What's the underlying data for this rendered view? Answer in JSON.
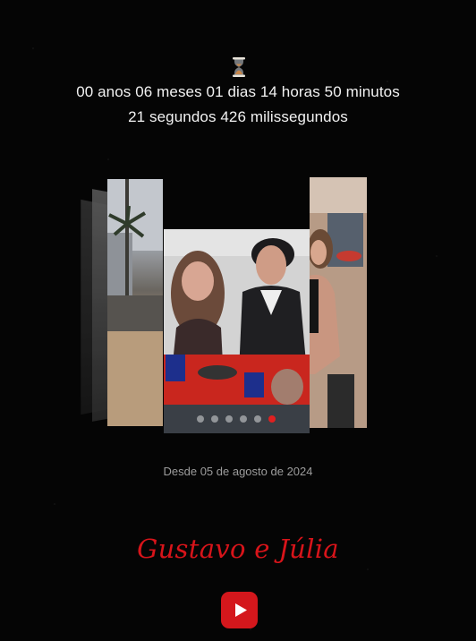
{
  "timer": {
    "icon": "hourglass-icon",
    "line1": "00 anos 06 meses 01 dias 14 horas 50 minutos",
    "line2": "21 segundos 426 milissegundos"
  },
  "carousel": {
    "photos": [
      {
        "name": "beach-photo",
        "description_hidden": true
      },
      {
        "name": "couple-party-photo",
        "description_hidden": true
      },
      {
        "name": "beach-woman-photo",
        "description_hidden": true
      }
    ],
    "dots_count": 6,
    "active_dot": 5
  },
  "since_text": "Desde 05 de agosto de 2024",
  "names": "Gustavo e Júlia",
  "play_button": {
    "icon": "play-icon",
    "color": "#d4171c"
  },
  "colors": {
    "background": "#050505",
    "accent": "#d8141a",
    "muted_text": "#9d9d9d"
  }
}
